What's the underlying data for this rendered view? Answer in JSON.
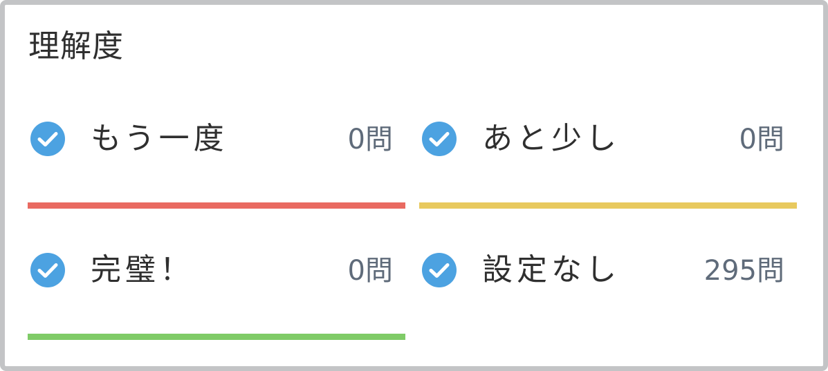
{
  "panel": {
    "title": "理解度"
  },
  "colors": {
    "check": "#4ca2e1",
    "red": "#e96a61",
    "yellow": "#e8c95e",
    "green": "#7fcb67"
  },
  "items": [
    {
      "label": "もう一度",
      "count": "0問",
      "bar_color": "#e96a61",
      "icon": "check-circle-icon"
    },
    {
      "label": "あと少し",
      "count": "0問",
      "bar_color": "#e8c95e",
      "icon": "check-circle-icon"
    },
    {
      "label": "完璧！",
      "count": "0問",
      "bar_color": "#7fcb67",
      "icon": "check-circle-icon"
    },
    {
      "label": "設定なし",
      "count": "295問",
      "bar_color": "",
      "icon": "check-circle-icon"
    }
  ]
}
